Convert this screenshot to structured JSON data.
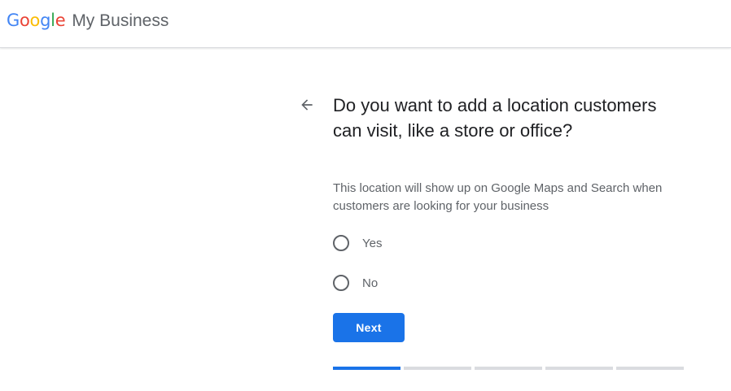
{
  "header": {
    "logo_letters": [
      "G",
      "o",
      "o",
      "g",
      "l",
      "e"
    ],
    "product_name": "My Business"
  },
  "question": {
    "title": "Do you want to add a location customers can visit, like a store or office?",
    "subtitle": "This location will show up on Google Maps and Search when customers are looking for your business"
  },
  "options": [
    {
      "label": "Yes",
      "selected": false
    },
    {
      "label": "No",
      "selected": false
    }
  ],
  "actions": {
    "next_label": "Next"
  },
  "progress": {
    "total_steps": 5,
    "current_step": 1
  },
  "colors": {
    "accent": "#1a73e8",
    "text_primary": "#202124",
    "text_secondary": "#5f6368",
    "progress_track": "#dadce0",
    "logo_blue": "#4285f4",
    "logo_red": "#ea4335",
    "logo_yellow": "#fbbc05",
    "logo_green": "#34a853"
  },
  "icons": {
    "back": "arrow-back-icon"
  }
}
